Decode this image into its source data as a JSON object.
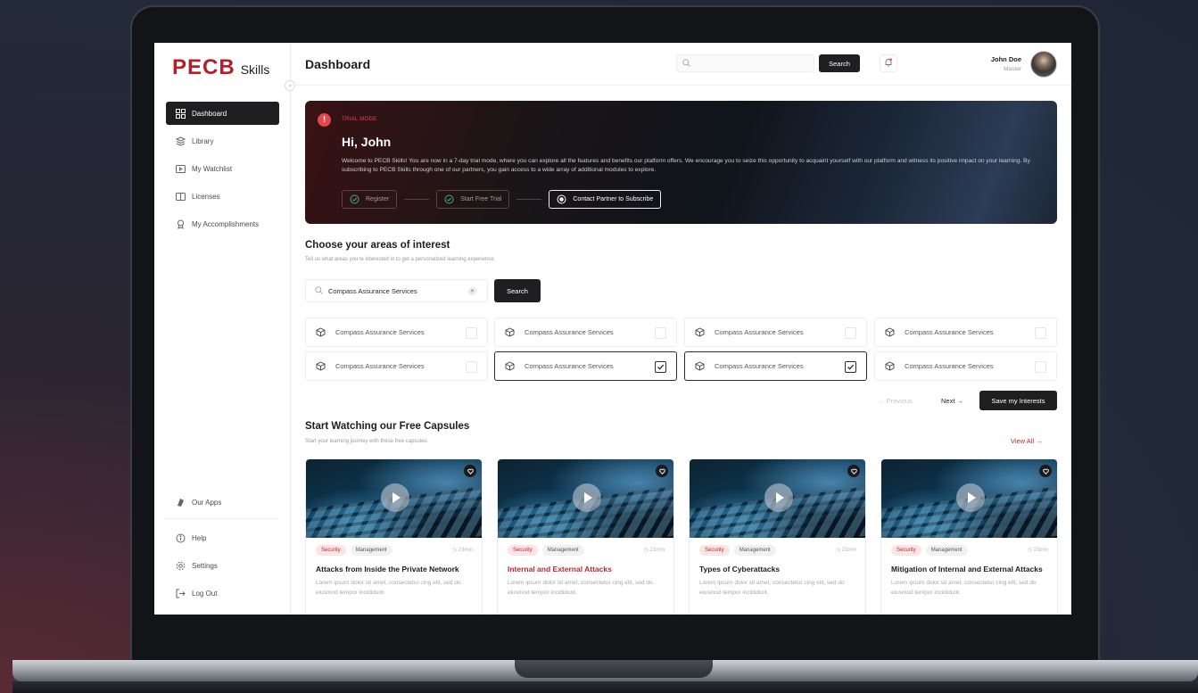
{
  "app": {
    "logo_main": "PECB",
    "logo_sub": "Skills"
  },
  "sidebar": {
    "items": [
      {
        "label": "Dashboard",
        "icon": "dashboard-icon",
        "active": true
      },
      {
        "label": "Library",
        "icon": "library-icon",
        "active": false
      },
      {
        "label": "My Watchlist",
        "icon": "watchlist-icon",
        "active": false
      },
      {
        "label": "Licenses",
        "icon": "licenses-icon",
        "active": false
      },
      {
        "label": "My Accomplishments",
        "icon": "trophy-icon",
        "active": false
      }
    ],
    "bottom_items": [
      {
        "label": "Our Apps",
        "icon": "apps-icon"
      },
      {
        "label": "Help",
        "icon": "help-icon"
      },
      {
        "label": "Settings",
        "icon": "gear-icon"
      },
      {
        "label": "Log Out",
        "icon": "logout-icon"
      }
    ]
  },
  "header": {
    "title": "Dashboard",
    "search_placeholder": "",
    "search_button": "Search",
    "user_name": "John Doe",
    "user_role": "Master"
  },
  "banner": {
    "mode_label": "TRIAL MODE",
    "greeting": "Hi, John",
    "text": "Welcome to PECB Skills! You are now in a 7-day trial mode, where you can explore all the features and benefits our platform offers. We encourage you to seize this opportunity to acquaint yourself with our platform and witness its positive impact on your learning. By subscribing to PECB Skills through one of our partners, you gain access to a wide array of additional modules to explore.",
    "steps": [
      "Register",
      "Start Free Trial",
      "Contact Partner to Subscribe"
    ]
  },
  "interests": {
    "title": "Choose your areas of interest",
    "subtitle": "Tell us what areas you're interested in to get a personalized learning experience.",
    "search_value": "Compass Assurance Services",
    "search_button": "Search",
    "tiles": [
      {
        "label": "Compass Assurance Services",
        "checked": false
      },
      {
        "label": "Compass Assurance Services",
        "checked": false
      },
      {
        "label": "Compass Assurance Services",
        "checked": false
      },
      {
        "label": "Compass Assurance Services",
        "checked": false
      },
      {
        "label": "Compass Assurance Services",
        "checked": false
      },
      {
        "label": "Compass Assurance Services",
        "checked": true
      },
      {
        "label": "Compass Assurance Services",
        "checked": true
      },
      {
        "label": "Compass Assurance Services",
        "checked": false
      }
    ],
    "previous": "Previous",
    "next": "Next",
    "save_button": "Save my Interests"
  },
  "capsules": {
    "title": "Start Watching our Free Capsules",
    "subtitle": "Start your learning journey with these free capsules.",
    "view_all": "View All",
    "cards": [
      {
        "tag1": "Security",
        "tag2": "Management",
        "duration": "23min",
        "title": "Attacks from Inside the Private Network",
        "highlight": false,
        "desc": "Lorem ipsum dolor sit amet, consectetur cing elit, sed do eiusmod tempor incididunt."
      },
      {
        "tag1": "Security",
        "tag2": "Management",
        "duration": "23min",
        "title": "Internal and External Attacks",
        "highlight": true,
        "desc": "Lorem ipsum dolor sit amet, consectetur cing elit, sed do eiusmod tempor incididunt."
      },
      {
        "tag1": "Security",
        "tag2": "Management",
        "duration": "23min",
        "title": "Types of Cyberattacks",
        "highlight": false,
        "desc": "Lorem ipsum dolor sit amet, consectetur cing elit, sed do eiusmod tempor incididunt."
      },
      {
        "tag1": "Security",
        "tag2": "Management",
        "duration": "23min",
        "title": "Mitigation of Internal and External Attacks",
        "highlight": false,
        "desc": "Lorem ipsum dolor sit amet, consectetur cing elit, sed do eiusmod tempor incididunt."
      }
    ]
  },
  "colors": {
    "brand_red": "#b3202c",
    "dark": "#1f1f22",
    "alert_red": "#e2474e"
  }
}
